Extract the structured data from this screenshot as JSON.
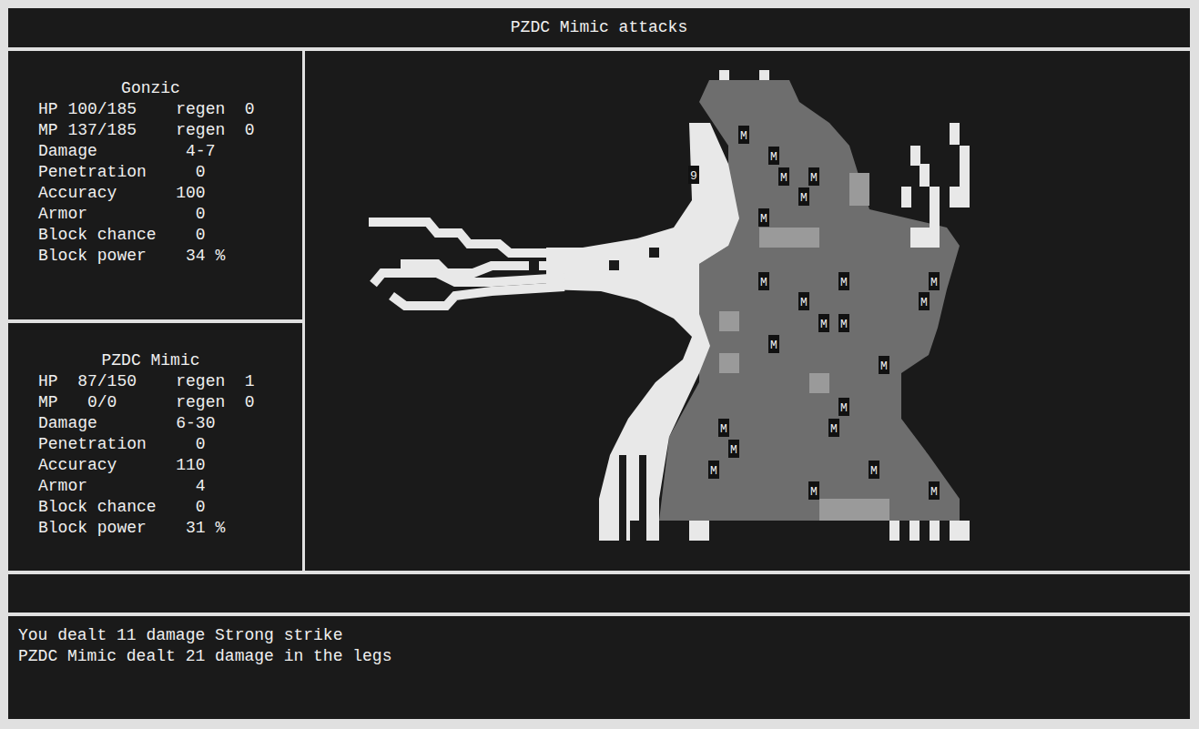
{
  "header": {
    "title": "PZDC Mimic attacks"
  },
  "combatants": [
    {
      "name": "Gonzic",
      "stats": [
        "HP 100/185    regen  0",
        "MP 137/185    regen  0",
        "Damage         4-7",
        "Penetration     0",
        "Accuracy      100",
        "Armor           0",
        "Block chance    0",
        "Block power    34 %"
      ]
    },
    {
      "name": "PZDC Mimic",
      "stats": [
        "HP  87/150    regen  1",
        "MP   0/0      regen  0",
        "Damage        6-30",
        "Penetration     0",
        "Accuracy      110",
        "Armor           4",
        "Block chance    0",
        "Block power    31 %"
      ]
    }
  ],
  "creature": {
    "marks": [
      "9",
      "M",
      "M",
      "M",
      "M",
      "M",
      "M",
      "M",
      "M",
      "M",
      "M",
      "M",
      "M",
      "M",
      "M",
      "M",
      "M",
      "M",
      "M",
      "M",
      "M",
      "M",
      "M",
      "M"
    ]
  },
  "log": [
    "You dealt 11 damage Strong strike",
    "PZDC Mimic dealt 21 damage in the legs"
  ]
}
